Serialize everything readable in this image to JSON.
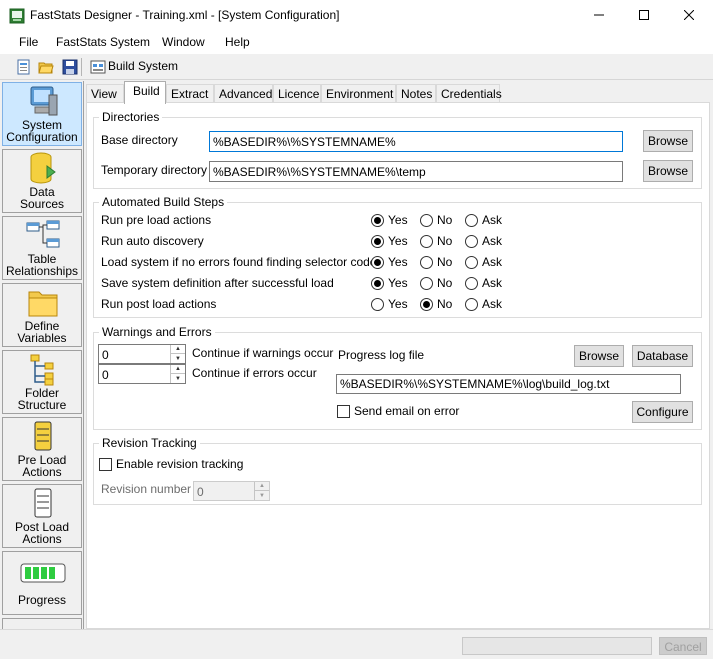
{
  "window": {
    "title": "FastStats Designer - Training.xml - [System Configuration]",
    "minimize_glyph": "─",
    "maximize_glyph": "☐",
    "close_glyph": "✕"
  },
  "menu": [
    "File",
    "FastStats System",
    "Window",
    "Help"
  ],
  "toolbar": {
    "icons": [
      "new-icon",
      "open-folder-icon",
      "save-icon",
      "build-icon"
    ],
    "build_label": "Build System"
  },
  "sidebar": [
    {
      "label1": "System",
      "label2": "Configuration",
      "icon": "computer-icon",
      "active": true
    },
    {
      "label1": "Data",
      "label2": "Sources",
      "icon": "database-icon",
      "active": false
    },
    {
      "label1": "Table",
      "label2": "Relationships",
      "icon": "table-relationships-icon",
      "active": false
    },
    {
      "label1": "Define",
      "label2": "Variables",
      "icon": "folder-icon",
      "active": false
    },
    {
      "label1": "Folder",
      "label2": "Structure",
      "icon": "folder-structure-icon",
      "active": false
    },
    {
      "label1": "Pre Load",
      "label2": "Actions",
      "icon": "pre-load-icon",
      "active": false
    },
    {
      "label1": "Post Load",
      "label2": "Actions",
      "icon": "post-load-icon",
      "active": false
    },
    {
      "label1": "Progress",
      "label2": "",
      "icon": "progress-icon",
      "active": false
    }
  ],
  "tabs": [
    "View",
    "Build",
    "Extract",
    "Advanced",
    "Licence",
    "Environment",
    "Notes",
    "Credentials"
  ],
  "active_tab": "Build",
  "directories": {
    "title": "Directories",
    "base_label": "Base directory",
    "base_value": "%BASEDIR%\\%SYSTEMNAME%",
    "temp_label": "Temporary directory",
    "temp_value": "%BASEDIR%\\%SYSTEMNAME%\\temp",
    "browse_label": "Browse"
  },
  "build_steps": {
    "title": "Automated Build Steps",
    "options": [
      "Yes",
      "No",
      "Ask"
    ],
    "rows": [
      {
        "label": "Run pre load actions",
        "selected": "Yes"
      },
      {
        "label": "Run auto discovery",
        "selected": "Yes"
      },
      {
        "label": "Load system if no errors found finding selector codes",
        "selected": "Yes"
      },
      {
        "label": "Save system definition after successful load",
        "selected": "Yes"
      },
      {
        "label": "Run post load actions",
        "selected": "No"
      }
    ]
  },
  "warnings": {
    "title": "Warnings and Errors",
    "warnings_value": "0",
    "warnings_label": "Continue if warnings occur",
    "errors_value": "0",
    "errors_label": "Continue if errors occur",
    "progress_log_label": "Progress log file",
    "browse_label": "Browse",
    "database_label": "Database",
    "log_path": "%BASEDIR%\\%SYSTEMNAME%\\log\\build_log.txt",
    "send_email_label": "Send email on error",
    "send_email_checked": false,
    "configure_label": "Configure"
  },
  "revision": {
    "title": "Revision Tracking",
    "enable_label": "Enable revision tracking",
    "enable_checked": false,
    "number_label": "Revision number",
    "number_value": "0"
  },
  "statusbar": {
    "cancel_label": "Cancel"
  }
}
